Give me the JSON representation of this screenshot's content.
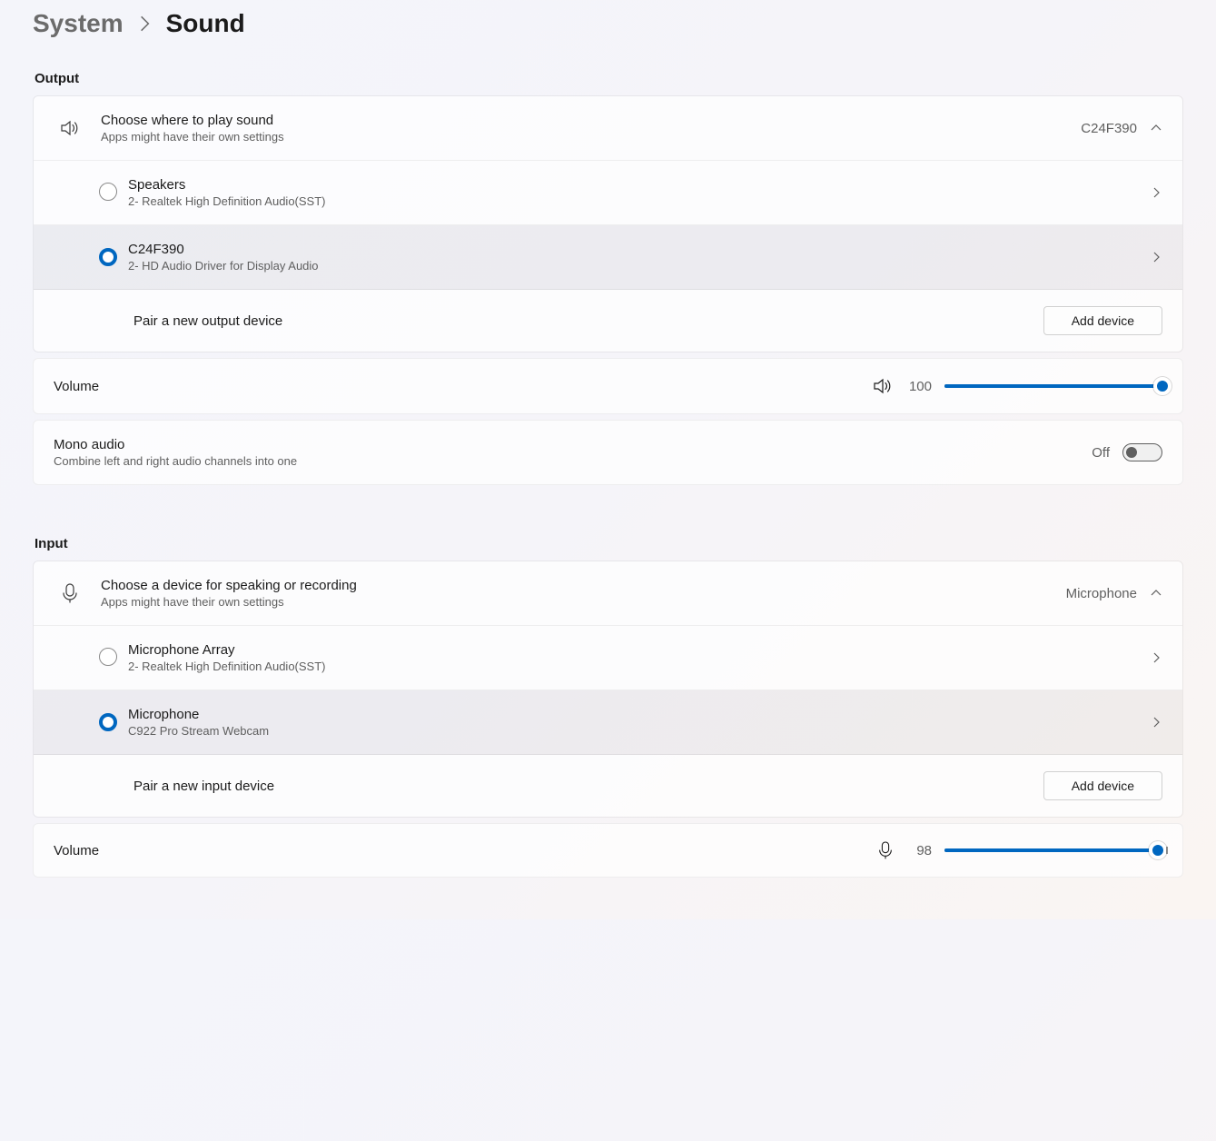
{
  "breadcrumb": {
    "parent": "System",
    "current": "Sound"
  },
  "output": {
    "label": "Output",
    "chooser": {
      "title": "Choose where to play sound",
      "subtitle": "Apps might have their own settings",
      "value": "C24F390"
    },
    "devices": [
      {
        "name": "Speakers",
        "driver": "2- Realtek High Definition Audio(SST)",
        "selected": false
      },
      {
        "name": "C24F390",
        "driver": "2- HD Audio Driver for Display Audio",
        "selected": true
      }
    ],
    "pair": {
      "label": "Pair a new output device",
      "button": "Add device"
    },
    "volume": {
      "label": "Volume",
      "value": "100",
      "percent": 100
    },
    "mono": {
      "title": "Mono audio",
      "subtitle": "Combine left and right audio channels into one",
      "state_label": "Off"
    }
  },
  "input": {
    "label": "Input",
    "chooser": {
      "title": "Choose a device for speaking or recording",
      "subtitle": "Apps might have their own settings",
      "value": "Microphone"
    },
    "devices": [
      {
        "name": "Microphone Array",
        "driver": "2- Realtek High Definition Audio(SST)",
        "selected": false
      },
      {
        "name": "Microphone",
        "driver": "C922 Pro Stream Webcam",
        "selected": true
      }
    ],
    "pair": {
      "label": "Pair a new input device",
      "button": "Add device"
    },
    "volume": {
      "label": "Volume",
      "value": "98",
      "percent": 98
    }
  }
}
